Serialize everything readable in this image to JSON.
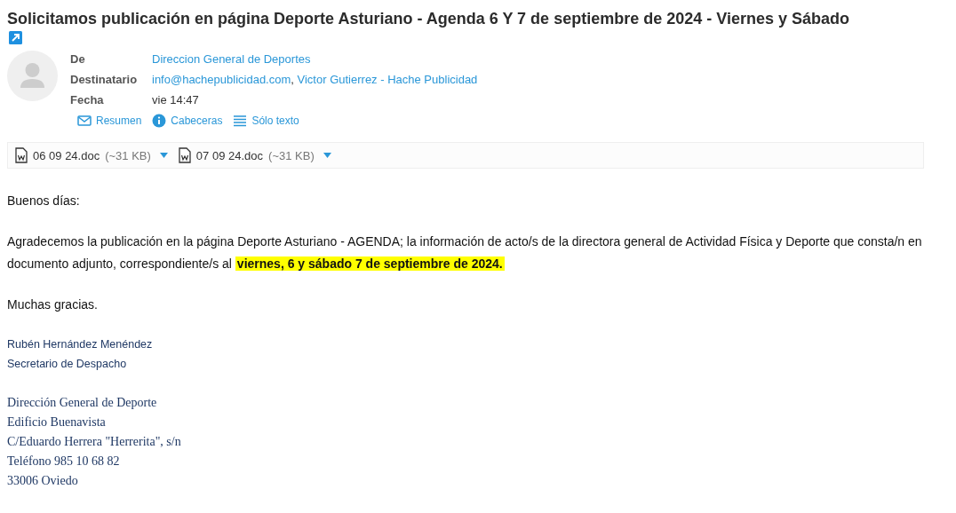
{
  "subject": "Solicitamos publicación en página Deporte Asturiano - Agenda 6 Y 7 de septiembre de 2024 - Viernes y Sábado",
  "headers": {
    "from_label": "De",
    "from": "Direccion General de Deportes",
    "to_label": "Destinatario",
    "to": [
      "info@hachepublicidad.com",
      "Victor Gutierrez - Hache Publicidad"
    ],
    "to_separator": ",",
    "date_label": "Fecha",
    "date": "vie 14:47"
  },
  "views": [
    {
      "kind": "summary",
      "label": "Resumen"
    },
    {
      "kind": "headers",
      "label": "Cabeceras"
    },
    {
      "kind": "text",
      "label": "Sólo texto"
    }
  ],
  "attachments": [
    {
      "name": "06 09 24.doc",
      "size": "(~31 KB)"
    },
    {
      "name": "07 09 24.doc",
      "size": "(~31 KB)"
    }
  ],
  "body": [
    "Buenos días:",
    "Agradecemos la publicación en la página Deporte Asturiano - AGENDA; la información de acto/s de la directora general de Actividad Física y Deporte que consta/n en documento adjunto, correspondiente/s al **viernes, 6 y sábado 7 de septiembre de 2024.**",
    "Muchas gracias."
  ],
  "signature": [
    {
      "kind": "sans",
      "lines": [
        "Rubén Hernández Menéndez",
        "Secretario de Despacho"
      ]
    },
    {
      "kind": "serif",
      "lines": [
        "Dirección General de Deporte",
        "Edificio Buenavista",
        "C/Eduardo Herrera \"Herrerita\", s/n",
        "Teléfono 985 10 68 82",
        "33006 Oviedo"
      ]
    }
  ]
}
